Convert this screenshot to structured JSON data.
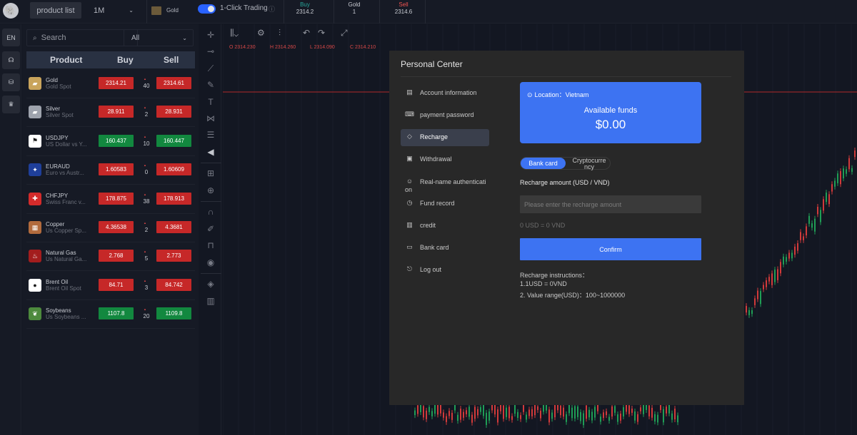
{
  "topbar": {
    "product_list_label": "product list",
    "timeframe": "1M",
    "symbol": "Gold",
    "one_click_label": "1-Click Trading",
    "quotes": {
      "buy_label": "Buy",
      "buy_value": "2314.2",
      "gold_label": "Gold",
      "gold_value": "1",
      "sell_label": "Sell",
      "sell_value": "2314.6"
    }
  },
  "rail": {
    "language": "EN"
  },
  "product_panel": {
    "search_placeholder": "Search",
    "filter_value": "All",
    "headers": {
      "product": "Product",
      "buy": "Buy",
      "sell": "Sell"
    },
    "rows": [
      {
        "name": "Gold",
        "sub": "Gold Spot",
        "buy": "2314.21",
        "spread": "40",
        "sell": "2314.61",
        "buy_color": "red",
        "sell_color": "red"
      },
      {
        "name": "Silver",
        "sub": "Silver Spot",
        "buy": "28.911",
        "spread": "2",
        "sell": "28.931",
        "buy_color": "red",
        "sell_color": "red"
      },
      {
        "name": "USDJPY",
        "sub": "US Dollar vs Y...",
        "buy": "160.437",
        "spread": "10",
        "sell": "160.447",
        "buy_color": "green",
        "sell_color": "green"
      },
      {
        "name": "EURAUD",
        "sub": "Euro vs Austr...",
        "buy": "1.60583",
        "spread": "0",
        "sell": "1.60609",
        "buy_color": "red",
        "sell_color": "red"
      },
      {
        "name": "CHFJPY",
        "sub": "Swiss Franc v...",
        "buy": "178.875",
        "spread": "38",
        "sell": "178.913",
        "buy_color": "red",
        "sell_color": "red"
      },
      {
        "name": "Copper",
        "sub": "Us Copper Sp...",
        "buy": "4.36538",
        "spread": "2",
        "sell": "4.3681",
        "buy_color": "red",
        "sell_color": "red"
      },
      {
        "name": "Natural Gas",
        "sub": "Us Natural Ga...",
        "buy": "2.768",
        "spread": "5",
        "sell": "2.773",
        "buy_color": "red",
        "sell_color": "red"
      },
      {
        "name": "Brent Oil",
        "sub": "Brent Oil Spot",
        "buy": "84.71",
        "spread": "3",
        "sell": "84.742",
        "buy_color": "red",
        "sell_color": "red"
      },
      {
        "name": "Soybeans",
        "sub": "Us Soybeans ...",
        "buy": "1107.8",
        "spread": "20",
        "sell": "1109.8",
        "buy_color": "green",
        "sell_color": "green"
      }
    ]
  },
  "chart_header": {
    "open": "O 2314.230",
    "high": "H 2314.260",
    "low": "L 2314.090",
    "close": "C 2314.210"
  },
  "personal_center": {
    "title": "Personal Center",
    "menu": [
      {
        "label": "Account information",
        "icon": "document-icon"
      },
      {
        "label": "payment password",
        "icon": "password-icon"
      },
      {
        "label": "Recharge",
        "icon": "recharge-icon"
      },
      {
        "label": "Withdrawal",
        "icon": "withdrawal-icon"
      },
      {
        "label": "Real-name authenticati on",
        "icon": "id-card-icon"
      },
      {
        "label": "Fund record",
        "icon": "clock-icon"
      },
      {
        "label": "credit",
        "icon": "credit-icon"
      },
      {
        "label": "Bank card",
        "icon": "bank-card-icon"
      },
      {
        "label": "Log out",
        "icon": "logout-icon"
      }
    ],
    "location": "Location：Vietnam",
    "available_label": "Available funds",
    "available_value": "$0.00",
    "tabs": {
      "bank_card": "Bank card",
      "crypto": "Cryptocurre ncy"
    },
    "amount_label": "Recharge amount (USD / VND)",
    "amount_placeholder": "Please enter the recharge amount",
    "conversion": "0 USD = 0 VND",
    "confirm_label": "Confirm",
    "instructions_title": "Recharge instructions：",
    "instruction_1": "1.1USD = 0VND",
    "instruction_2": "2. Value range(USD)：100~1000000"
  }
}
